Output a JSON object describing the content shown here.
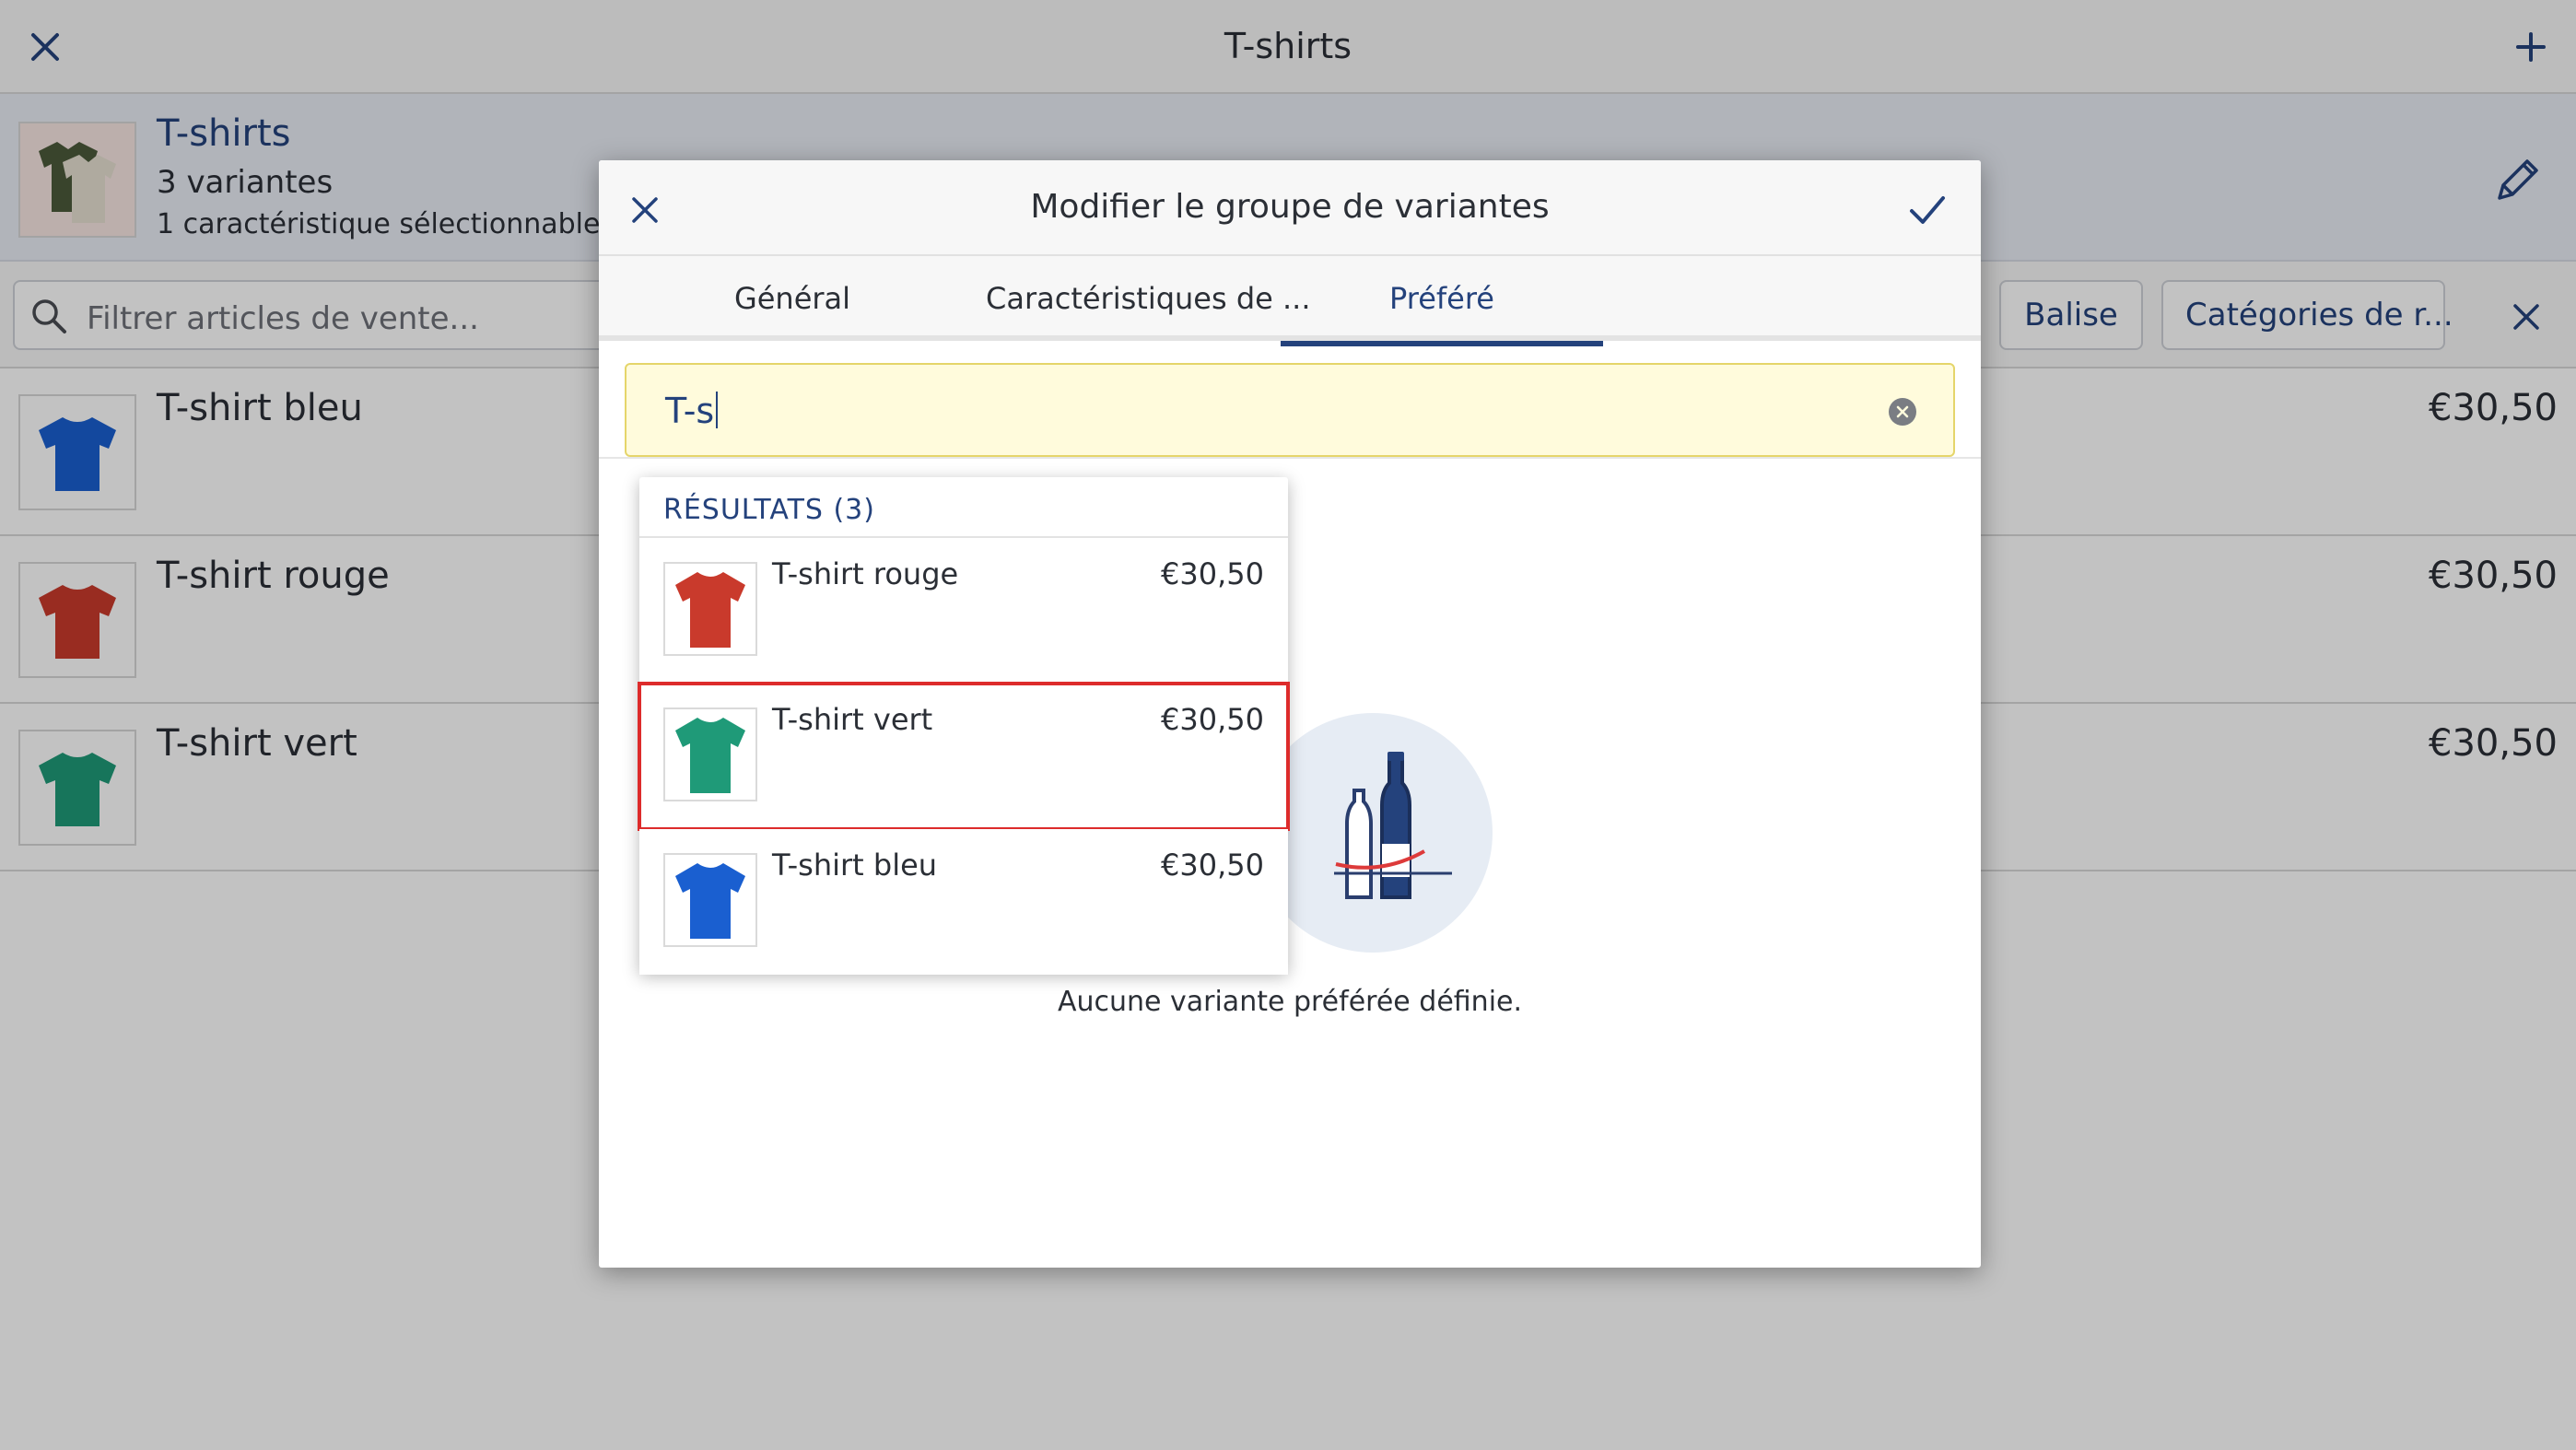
{
  "window": {
    "title": "T-shirts"
  },
  "group": {
    "title": "T-shirts",
    "variants_count": "3 variantes",
    "selectable_features": "1 caractéristique sélectionnable"
  },
  "filter": {
    "placeholder": "Filtrer articles de vente...",
    "tag_button": "Balise",
    "categories_button": "Catégories de r..."
  },
  "articles": [
    {
      "name": "T-shirt bleu",
      "price": "€30,50",
      "color": "#1a5fd0"
    },
    {
      "name": "T-shirt rouge",
      "price": "€30,50",
      "color": "#c93a2c"
    },
    {
      "name": "T-shirt vert",
      "price": "€30,50",
      "color": "#1f9a78"
    }
  ],
  "modal": {
    "title": "Modifier le groupe de variantes",
    "tabs": [
      {
        "label": "Général"
      },
      {
        "label": "Caractéristiques de ..."
      },
      {
        "label": "Préféré"
      }
    ],
    "search": {
      "value": "T-s"
    },
    "empty_message": "Aucune variante préférée définie."
  },
  "dropdown": {
    "header": "RÉSULTATS (3)",
    "results": [
      {
        "name": "T-shirt rouge",
        "price": "€30,50",
        "color": "#c93a2c"
      },
      {
        "name": "T-shirt vert",
        "price": "€30,50",
        "color": "#1f9a78"
      },
      {
        "name": "T-shirt bleu",
        "price": "€30,50",
        "color": "#1a5fd0"
      }
    ]
  },
  "colors": {
    "accent": "#24427c",
    "highlight_outline": "#dd2b2b",
    "search_bg": "#fffbdc"
  }
}
